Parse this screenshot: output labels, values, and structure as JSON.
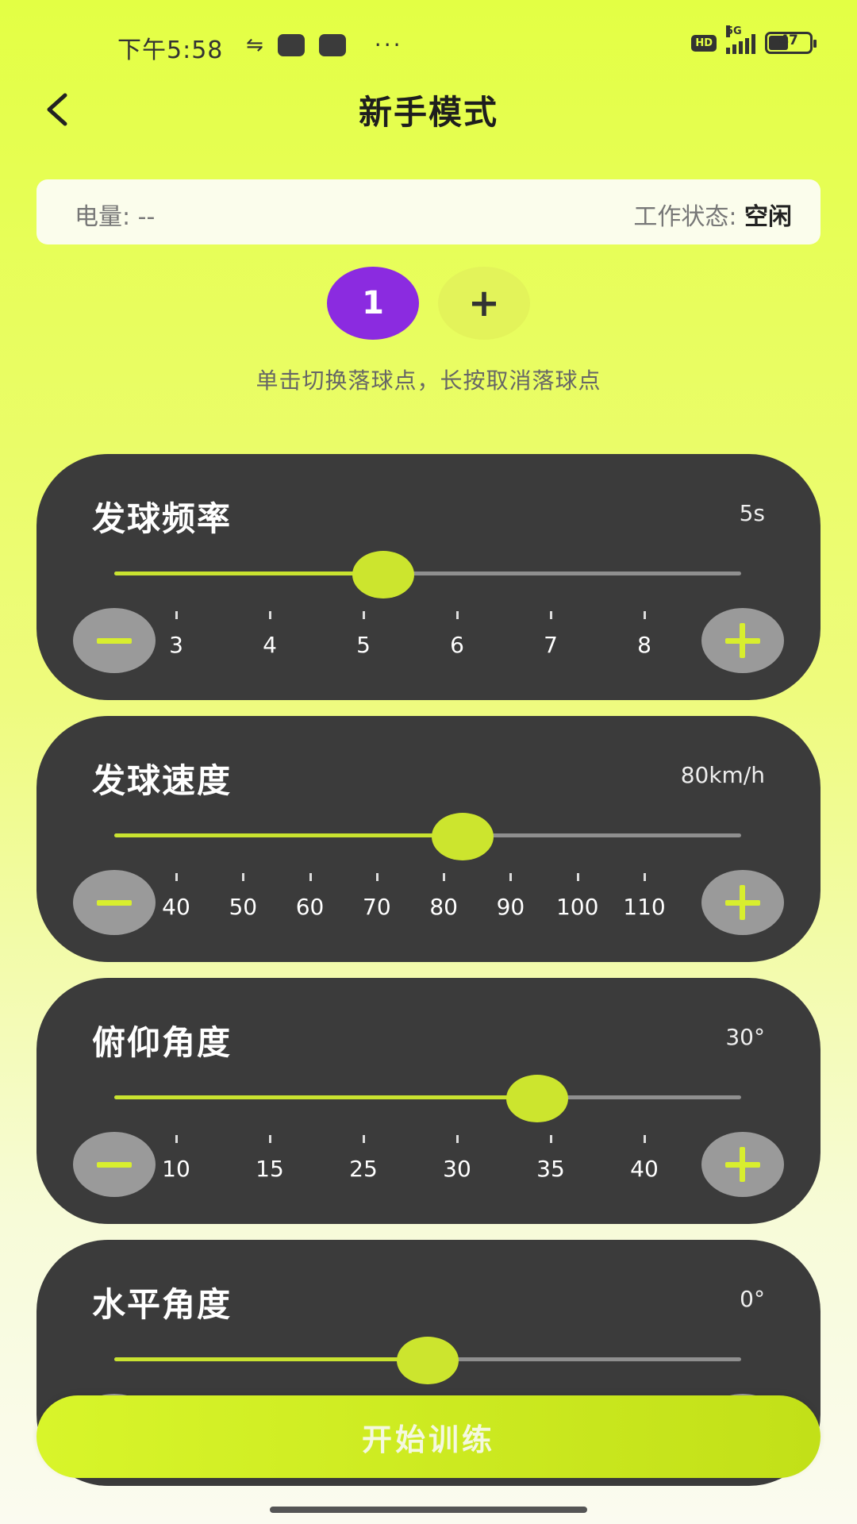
{
  "status_bar": {
    "time": "下午5:58",
    "network": "5G",
    "hd_badge": "HD",
    "battery": "47"
  },
  "header": {
    "title": "新手模式",
    "back_icon": "chevron-left-icon"
  },
  "info": {
    "battery_label": "电量:",
    "battery_value": "--",
    "status_label": "工作状态:",
    "status_value": "空闲"
  },
  "points": {
    "active_label": "1",
    "add_label": "+",
    "hint": "单击切换落球点，长按取消落球点"
  },
  "sliders": [
    {
      "title": "发球频率",
      "value_text": "5s",
      "value": 5,
      "min": 2,
      "max": 9,
      "ticks": [
        "3",
        "4",
        "5",
        "6",
        "7",
        "8"
      ]
    },
    {
      "title": "发球速度",
      "value_text": "80km/h",
      "value": 80,
      "min": 30,
      "max": 120,
      "ticks": [
        "40",
        "50",
        "60",
        "70",
        "80",
        "90",
        "100",
        "110"
      ]
    },
    {
      "title": "俯仰角度",
      "value_text": "30°",
      "value": 32,
      "min": 5,
      "max": 45,
      "ticks": [
        "10",
        "15",
        "25",
        "30",
        "35",
        "40"
      ]
    },
    {
      "title": "水平角度",
      "value_text": "0°",
      "value": 0,
      "min": -40,
      "max": 40,
      "ticks": []
    }
  ],
  "start_button": "开始训练",
  "colors": {
    "accent": "#cce52e",
    "purple": "#8b2be0",
    "card": "#3b3b3b"
  }
}
